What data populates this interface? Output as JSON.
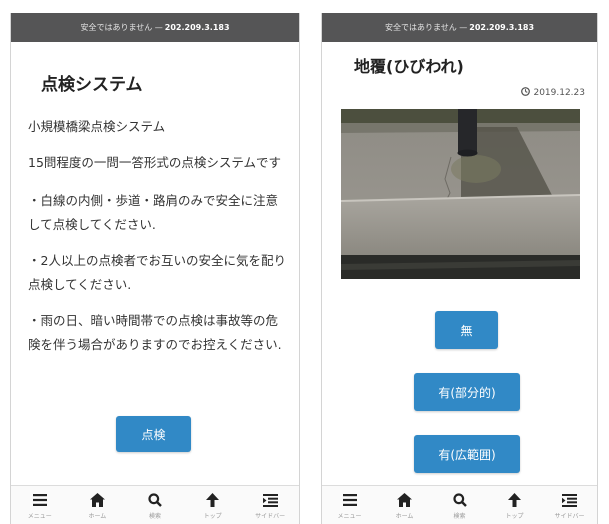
{
  "left": {
    "url_bar": {
      "warning": "安全ではありません —",
      "address": "202.209.3.183"
    },
    "title": "点検システム",
    "paragraphs": [
      "小規模橋梁点検システム",
      "15問程度の一問一答形式の点検システムです",
      "・白線の内側・歩道・路肩のみで安全に注意して点検してください.",
      "・2人以上の点検者でお互いの安全に気を配り点検してください.",
      "・雨の日、暗い時間帯での点検は事故等の危険を伴う場合がありますのでお控えください."
    ],
    "start_button": "点検"
  },
  "right": {
    "url_bar": {
      "warning": "安全ではありません —",
      "address": "202.209.3.183"
    },
    "title": "地覆(ひびわれ)",
    "date": "2019.12.23",
    "answers": [
      "無",
      "有(部分的)",
      "有(広範囲)"
    ]
  },
  "nav": [
    {
      "icon": "menu-icon",
      "label": "メニュー"
    },
    {
      "icon": "home-icon",
      "label": "ホーム"
    },
    {
      "icon": "search-icon",
      "label": "検索"
    },
    {
      "icon": "arrow-up-icon",
      "label": "トップ"
    },
    {
      "icon": "sidebar-icon",
      "label": "サイドバー"
    }
  ],
  "colors": {
    "button": "#3189c6",
    "url_bar": "#555556"
  }
}
